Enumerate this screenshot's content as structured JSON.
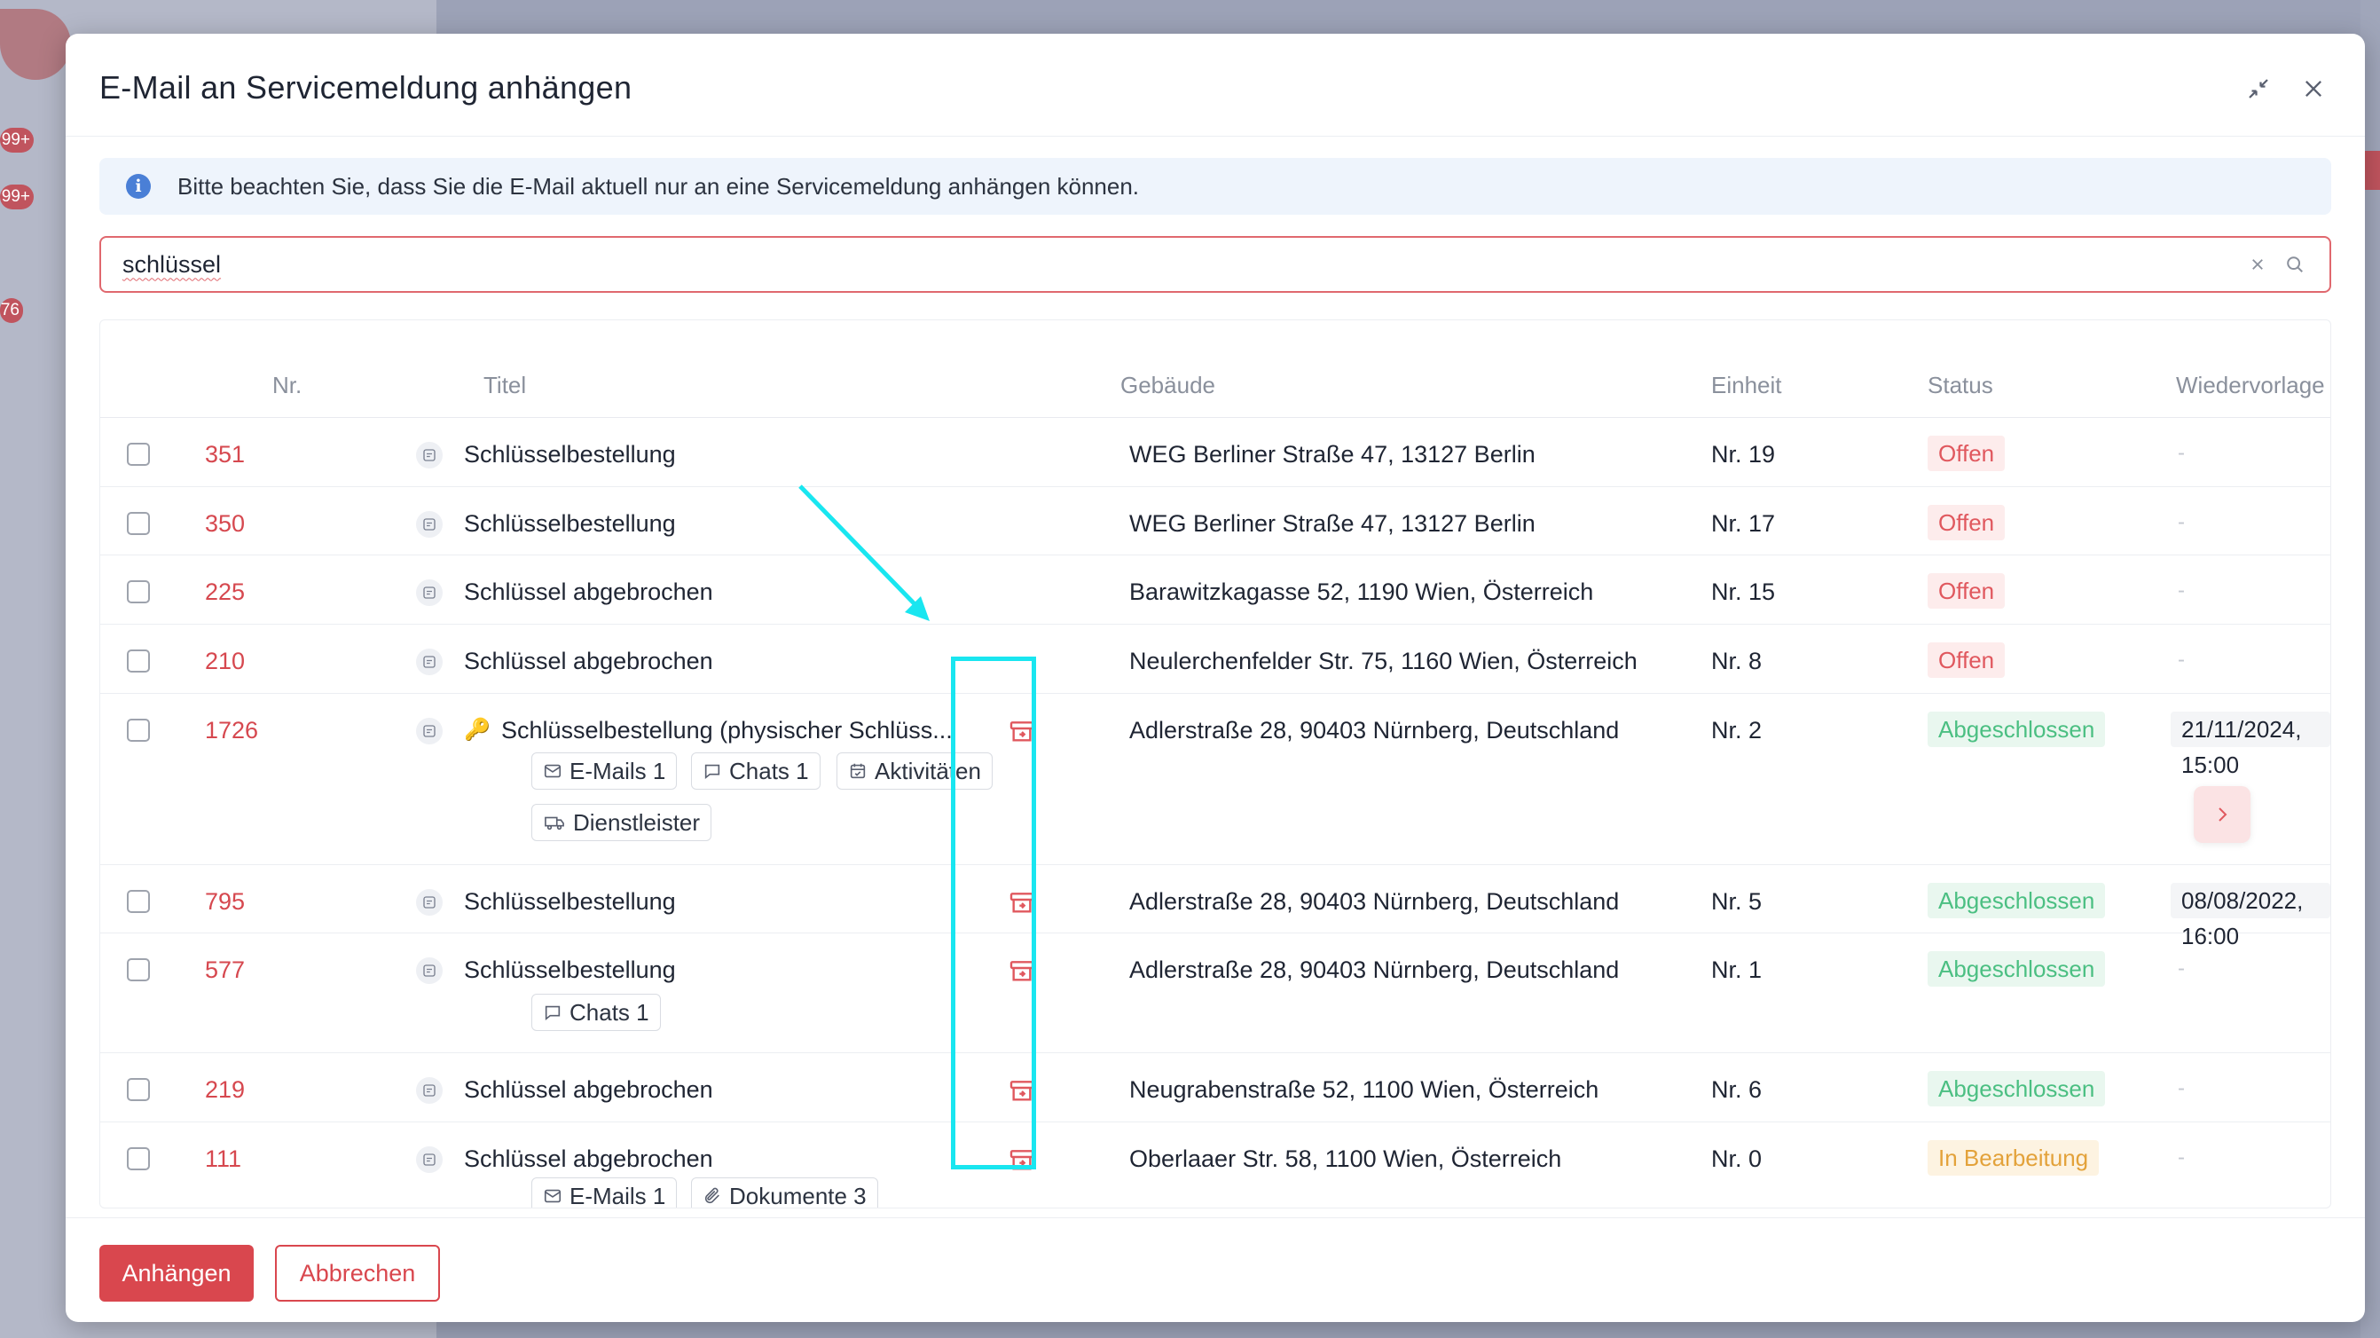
{
  "dialog": {
    "title": "E-Mail an Servicemeldung anhängen",
    "info": "Bitte beachten Sie, dass Sie die E-Mail aktuell nur an eine Servicemeldung anhängen können."
  },
  "search": {
    "value": "schlüssel"
  },
  "background": {
    "badges": [
      "99+",
      "99+",
      "76"
    ]
  },
  "table": {
    "headers": {
      "nr": "Nr.",
      "titel": "Titel",
      "gebaeude": "Gebäude",
      "einheit": "Einheit",
      "status": "Status",
      "wiedervorlage": "Wiedervorlage"
    },
    "rows": [
      {
        "nr": "351",
        "title": "Schlüsselbestellung",
        "gebaeude": "WEG Berliner Straße 47, 13127 Berlin",
        "einheit": "Nr. 19",
        "status": "Offen",
        "wiedervorlage": "-"
      },
      {
        "nr": "350",
        "title": "Schlüsselbestellung",
        "gebaeude": "WEG Berliner Straße 47, 13127 Berlin",
        "einheit": "Nr. 17",
        "status": "Offen",
        "wiedervorlage": "-"
      },
      {
        "nr": "225",
        "title": "Schlüssel abgebrochen",
        "gebaeude": "Barawitzkagasse 52, 1190 Wien, Österreich",
        "einheit": "Nr. 15",
        "status": "Offen",
        "wiedervorlage": "-"
      },
      {
        "nr": "210",
        "title": "Schlüssel abgebrochen",
        "gebaeude": "Neulerchenfelder Str. 75, 1160 Wien, Österreich",
        "einheit": "Nr. 8",
        "status": "Offen",
        "wiedervorlage": "-"
      },
      {
        "nr": "1726",
        "title": "Schlüsselbestellung (physischer Schlüss...",
        "gebaeude": "Adlerstraße 28, 90403 Nürnberg, Deutschland",
        "einheit": "Nr. 2",
        "status": "Abgeschlossen",
        "wiedervorlage": "21/11/2024, 15:00",
        "chips": [
          "E-Mails 1",
          "Chats 1",
          "Aktivitäten",
          "Dienstleister"
        ]
      },
      {
        "nr": "795",
        "title": "Schlüsselbestellung",
        "gebaeude": "Adlerstraße 28, 90403 Nürnberg, Deutschland",
        "einheit": "Nr. 5",
        "status": "Abgeschlossen",
        "wiedervorlage": "08/08/2022, 16:00"
      },
      {
        "nr": "577",
        "title": "Schlüsselbestellung",
        "gebaeude": "Adlerstraße 28, 90403 Nürnberg, Deutschland",
        "einheit": "Nr. 1",
        "status": "Abgeschlossen",
        "wiedervorlage": "-",
        "chips": [
          "Chats 1"
        ]
      },
      {
        "nr": "219",
        "title": "Schlüssel abgebrochen",
        "gebaeude": "Neugrabenstraße 52, 1100 Wien, Österreich",
        "einheit": "Nr. 6",
        "status": "Abgeschlossen",
        "wiedervorlage": "-"
      },
      {
        "nr": "111",
        "title": "Schlüssel abgebrochen",
        "gebaeude": "Oberlaaer Str. 58, 1100 Wien, Österreich",
        "einheit": "Nr. 0",
        "status": "In Bearbeitung",
        "wiedervorlage": "-",
        "chips": [
          "E-Mails 1",
          "Dokumente 3"
        ]
      }
    ]
  },
  "footer": {
    "attach": "Anhängen",
    "cancel": "Abbrechen"
  },
  "colors": {
    "accent": "#d9474e",
    "annotation": "#19e6f0"
  },
  "icons": [
    "info-icon",
    "minimize-icon",
    "close-icon",
    "clear-icon",
    "search-icon",
    "ticket-icon",
    "key-icon",
    "archive-icon",
    "mail-icon",
    "chat-icon",
    "calendar-icon",
    "truck-icon",
    "paperclip-icon",
    "chevron-right-icon"
  ]
}
